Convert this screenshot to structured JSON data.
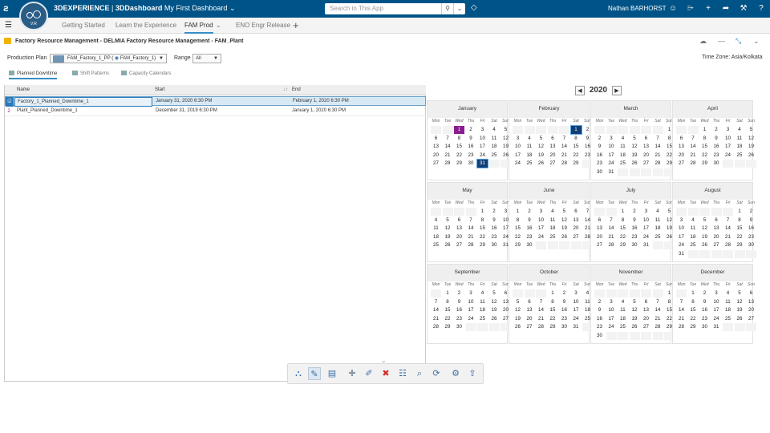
{
  "topbar": {
    "brand_prefix": "3DEXPERIENCE",
    "brand_sep": " | ",
    "brand_dash": "3DDashboard",
    "dashboard": "My First Dashboard",
    "search_placeholder": "Search in This App",
    "user": "Nathan BARHORST",
    "compass_version": "V.R"
  },
  "tabs": [
    "Getting Started",
    "Learn the Experience",
    "FAM Prod",
    "ENO Engr Release"
  ],
  "active_tab": "FAM Prod",
  "app": {
    "title": "Factory Resource Management - DELMIA Factory Resource Management - FAM_Plant",
    "timezone": "Time Zone: Asia/Kolkata"
  },
  "plan": {
    "label": "Production Plan",
    "value": "FAM_Factory_1_PP (",
    "value2": "FAM_Factory_1)",
    "range_label": "Range",
    "range_value": "All"
  },
  "subtabs": [
    "Planned Downtime",
    "Shift Patterns",
    "Capacity Calendars"
  ],
  "grid": {
    "columns": [
      "Name",
      "Start",
      "End"
    ],
    "rows": [
      {
        "num": "",
        "name": "Factory_1_Planned_Downtime_1",
        "start": "January 31, 2020 6:30 PM",
        "end": "February 1, 2020 6:30 PM",
        "selected": true
      },
      {
        "num": "2",
        "name": "Plant_Planned_Downtime_1",
        "start": "December 31, 2019 6:30 PM",
        "end": "January 1, 2020 6:30 PM",
        "selected": false
      }
    ]
  },
  "calendar": {
    "year": "2020",
    "dow": [
      "Mon",
      "Tue",
      "Wed",
      "Thu",
      "Fri",
      "Sat",
      "Sun"
    ],
    "months": [
      {
        "name": "January",
        "offset": 2,
        "days": 31,
        "purple": [
          1
        ],
        "blue": [
          31
        ]
      },
      {
        "name": "February",
        "offset": 5,
        "days": 29,
        "purple": [],
        "blue": [
          1
        ]
      },
      {
        "name": "March",
        "offset": 6,
        "days": 31,
        "purple": [],
        "blue": []
      },
      {
        "name": "April",
        "offset": 2,
        "days": 30,
        "purple": [],
        "blue": []
      },
      {
        "name": "May",
        "offset": 4,
        "days": 31,
        "purple": [],
        "blue": []
      },
      {
        "name": "June",
        "offset": 0,
        "days": 30,
        "purple": [],
        "blue": []
      },
      {
        "name": "July",
        "offset": 2,
        "days": 31,
        "purple": [],
        "blue": []
      },
      {
        "name": "August",
        "offset": 5,
        "days": 31,
        "purple": [],
        "blue": []
      },
      {
        "name": "September",
        "offset": 1,
        "days": 30,
        "purple": [],
        "blue": []
      },
      {
        "name": "October",
        "offset": 3,
        "days": 31,
        "purple": [],
        "blue": []
      },
      {
        "name": "November",
        "offset": 6,
        "days": 30,
        "purple": [],
        "blue": []
      },
      {
        "name": "December",
        "offset": 1,
        "days": 31,
        "purple": [],
        "blue": []
      }
    ]
  },
  "toolbar": [
    "factory-icon",
    "edit-icon",
    "document-icon",
    "add-icon",
    "pencil-icon",
    "delete-icon",
    "list-icon",
    "search-list-icon",
    "refresh-icon",
    "settings-icon",
    "export-icon"
  ],
  "colors": {
    "topbar": "#005386",
    "accent": "#368ec4",
    "purple": "#8b1c8f",
    "navy": "#123e76"
  }
}
